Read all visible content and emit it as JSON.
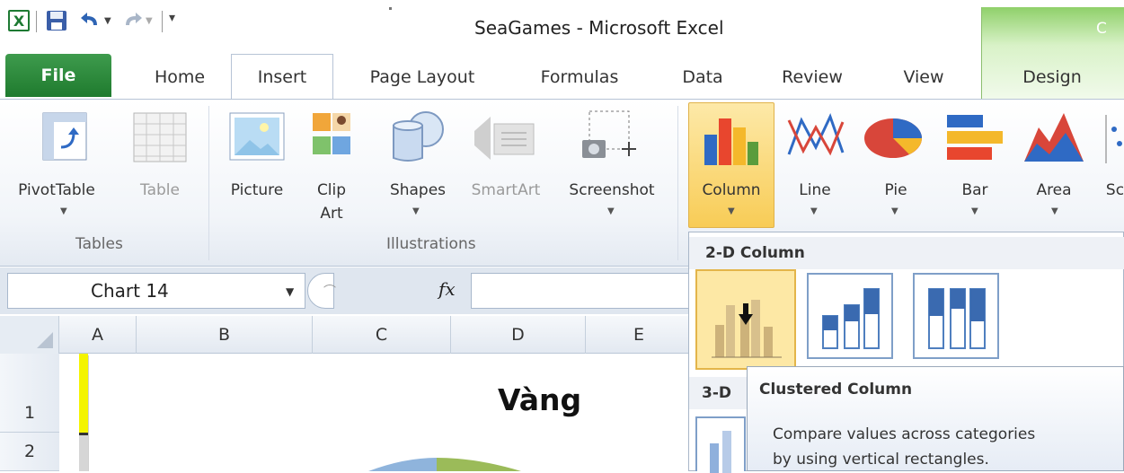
{
  "window": {
    "title": "SeaGames - Microsoft Excel",
    "context_tab_partial": "C"
  },
  "tabs": [
    "File",
    "Home",
    "Insert",
    "Page Layout",
    "Formulas",
    "Data",
    "Review",
    "View",
    "Design"
  ],
  "active_tab": "Insert",
  "ribbon": {
    "tables": {
      "pivottable": "PivotTable",
      "table": "Table",
      "group": "Tables"
    },
    "illustrations": {
      "picture": "Picture",
      "clip1": "Clip",
      "clip2": "Art",
      "shapes": "Shapes",
      "smartart": "SmartArt",
      "screenshot": "Screenshot",
      "group": "Illustrations"
    },
    "charts": {
      "column": "Column",
      "line": "Line",
      "pie": "Pie",
      "bar": "Bar",
      "area": "Area",
      "scatter_partial": "Sc"
    }
  },
  "formula_bar": {
    "name_box": "Chart 14",
    "fx": "fx"
  },
  "columns": [
    "A",
    "B",
    "C",
    "D",
    "E"
  ],
  "rows": [
    "1",
    "2"
  ],
  "chart": {
    "title": "Vàng"
  },
  "gallery": {
    "section_2d": "2-D Column",
    "section_3d": "3-D"
  },
  "tooltip": {
    "title": "Clustered Column",
    "line1": "Compare values across categories",
    "line2": "by using vertical rectangles."
  },
  "colors": {
    "file_tab": "#1f7b2e",
    "accent": "#f8cc56",
    "context_tab": "#8fd06a"
  }
}
